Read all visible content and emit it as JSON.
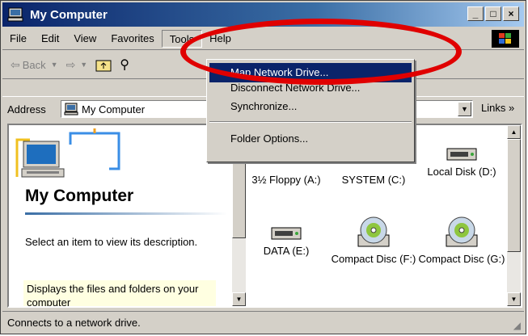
{
  "window": {
    "title": "My Computer",
    "minimize": "_",
    "maximize": "□",
    "close": "×"
  },
  "menubar": {
    "items": [
      "File",
      "Edit",
      "View",
      "Favorites",
      "Tools",
      "Help"
    ]
  },
  "toolbar": {
    "back_label": "Back",
    "search_label": "Search"
  },
  "address": {
    "label": "Address",
    "value": "My Computer",
    "links_label": "Links »"
  },
  "left_pane": {
    "title": "My Computer",
    "description": "Select an item to view its description.",
    "note": "Displays the files and folders on your computer"
  },
  "drives": [
    {
      "label": "3½ Floppy (A:)",
      "icon": "floppy-drive-icon"
    },
    {
      "label": "SYSTEM (C:)",
      "icon": "hard-disk-icon"
    },
    {
      "label": "Local Disk (D:)",
      "icon": "hard-disk-icon"
    },
    {
      "label": "DATA (E:)",
      "icon": "hard-disk-icon"
    },
    {
      "label": "Compact Disc (F:)",
      "icon": "cd-drive-icon"
    },
    {
      "label": "Compact Disc (G:)",
      "icon": "cd-drive-icon"
    }
  ],
  "tools_menu": {
    "items": [
      "Map Network Drive...",
      "Disconnect Network Drive...",
      "Synchronize...",
      "Folder Options..."
    ],
    "highlighted": "Map Network Drive..."
  },
  "status_bar": {
    "text": "Connects to a network drive."
  },
  "colors": {
    "highlight": "#0a246a",
    "annotation": "#e00000",
    "title_bar": "#0a246a"
  }
}
